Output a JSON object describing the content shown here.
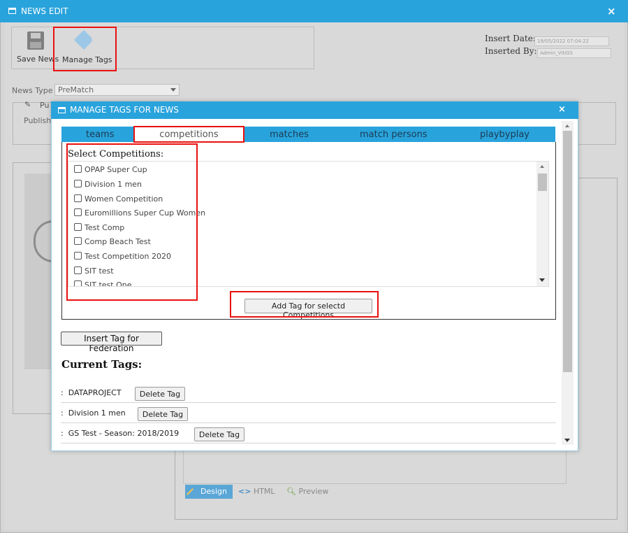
{
  "window": {
    "title": "NEWS EDIT",
    "close": "×"
  },
  "toolbar": {
    "save_label": "Save News",
    "manage_tags_label": "Manage Tags"
  },
  "meta": {
    "insert_date_label": "Insert Date:",
    "insert_date_value": "19/05/2022 07:04:22",
    "inserted_by_label": "Inserted By:",
    "inserted_by_value": "Admin_VitiGS"
  },
  "form": {
    "news_type_label": "News Type",
    "news_type_value": "PreMatch",
    "publish_legend": "Pu",
    "publish_label": "Publish"
  },
  "editor": {
    "tabs": {
      "design": "Design",
      "html": "HTML",
      "preview": "Preview"
    }
  },
  "modal": {
    "title": "MANAGE TAGS FOR NEWS",
    "close": "×",
    "tabs": [
      "teams",
      "competitions",
      "matches",
      "match persons",
      "playbyplay"
    ],
    "active_tab": "competitions",
    "select_title": "Select Competitions:",
    "competitions": [
      "OPAP Super Cup",
      "Division 1 men",
      "Women Competition",
      "Euromillions Super Cup Women",
      "Test Comp",
      "Comp Beach Test",
      "Test Competition 2020",
      "SIT test",
      "SIT test One"
    ],
    "add_tag_button": "Add Tag for selectd Competitions",
    "insert_federation_button": "Insert Tag for Federation",
    "current_tags_title": "Current Tags:",
    "tag_prefix": ":",
    "current_tags": [
      "DATAPROJECT",
      "Division 1 men",
      "GS Test - Season: 2018/2019"
    ],
    "delete_button": "Delete Tag"
  },
  "colors": {
    "accent": "#29a3dc",
    "highlight": "#e8110f"
  }
}
